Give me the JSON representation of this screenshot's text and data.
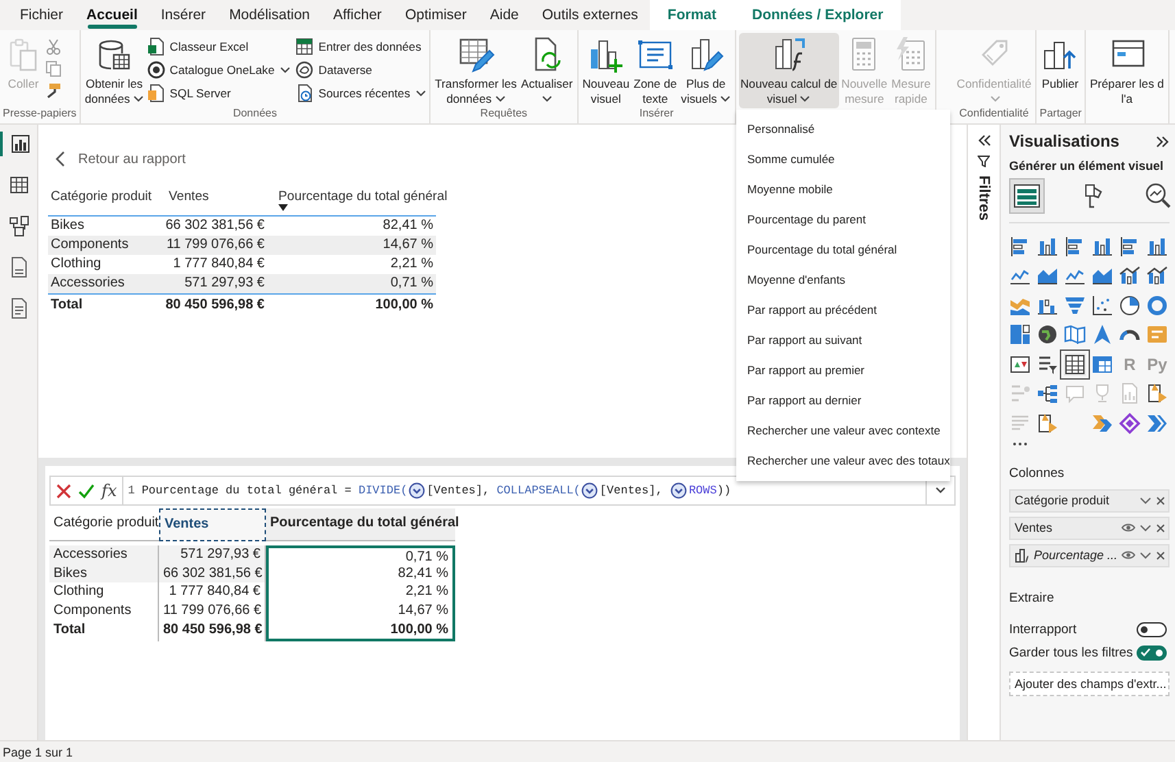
{
  "tabs": [
    {
      "label": "Fichier",
      "selected": false,
      "contextual": false
    },
    {
      "label": "Accueil",
      "selected": true,
      "contextual": false
    },
    {
      "label": "Insérer",
      "selected": false,
      "contextual": false
    },
    {
      "label": "Modélisation",
      "selected": false,
      "contextual": false
    },
    {
      "label": "Afficher",
      "selected": false,
      "contextual": false
    },
    {
      "label": "Optimiser",
      "selected": false,
      "contextual": false
    },
    {
      "label": "Aide",
      "selected": false,
      "contextual": false
    },
    {
      "label": "Outils externes",
      "selected": false,
      "contextual": false
    },
    {
      "label": "Format",
      "selected": false,
      "contextual": true
    },
    {
      "label": "Données / Explorer",
      "selected": false,
      "contextual": true
    }
  ],
  "ribbon": {
    "groups": [
      {
        "label": "Presse-papiers",
        "buttons": [
          {
            "kind": "large",
            "lines": [
              "Coller"
            ],
            "menu": false,
            "disabled": true,
            "pressed": false
          }
        ]
      },
      {
        "label": "Données",
        "buttons": [
          {
            "kind": "large",
            "lines": [
              "Obtenir les",
              "données"
            ],
            "menu": true,
            "disabled": false,
            "pressed": false
          },
          {
            "kind": "small",
            "label": "Classeur Excel",
            "menu": false
          },
          {
            "kind": "small",
            "label": "Catalogue OneLake",
            "menu": true
          },
          {
            "kind": "small",
            "label": "SQL Server",
            "menu": false
          },
          {
            "kind": "small",
            "label": "Entrer des données",
            "menu": false
          },
          {
            "kind": "small",
            "label": "Dataverse",
            "menu": false
          },
          {
            "kind": "small",
            "label": "Sources récentes",
            "menu": true
          }
        ]
      },
      {
        "label": "Requêtes",
        "buttons": [
          {
            "kind": "large",
            "lines": [
              "Transformer les",
              "données"
            ],
            "menu": true,
            "disabled": false,
            "pressed": false
          },
          {
            "kind": "large",
            "lines": [
              "Actualiser"
            ],
            "menu": true,
            "disabled": false,
            "pressed": false
          }
        ]
      },
      {
        "label": "Insérer",
        "buttons": [
          {
            "kind": "large",
            "lines": [
              "Nouveau",
              "visuel"
            ],
            "menu": false,
            "disabled": false,
            "pressed": false
          },
          {
            "kind": "large",
            "lines": [
              "Zone de",
              "texte"
            ],
            "menu": false,
            "disabled": false,
            "pressed": false
          },
          {
            "kind": "large",
            "lines": [
              "Plus de",
              "visuels"
            ],
            "menu": true,
            "disabled": false,
            "pressed": false
          }
        ]
      },
      {
        "buttons": [
          {
            "kind": "large",
            "lines": [
              "Nouveau calcul de",
              "visuel"
            ],
            "menu": true,
            "disabled": false,
            "pressed": true
          },
          {
            "kind": "large",
            "lines": [
              "Nouvelle",
              "mesure"
            ],
            "menu": false,
            "disabled": true,
            "pressed": false
          },
          {
            "kind": "large",
            "lines": [
              "Mesure",
              "rapide"
            ],
            "menu": false,
            "disabled": true,
            "pressed": false
          }
        ]
      },
      {
        "label": "Confidentialité",
        "buttons": [
          {
            "kind": "large",
            "lines": [
              "Confidentialité"
            ],
            "menu": true,
            "disabled": true,
            "pressed": false
          }
        ]
      },
      {
        "label": "Partager",
        "buttons": [
          {
            "kind": "large",
            "lines": [
              "Publier"
            ],
            "menu": false,
            "disabled": false,
            "pressed": false
          }
        ]
      },
      {
        "buttons": [
          {
            "kind": "large",
            "lines": [
              "Préparer les d",
              "l'a"
            ],
            "menu": false,
            "disabled": false,
            "pressed": false
          }
        ]
      }
    ]
  },
  "menu": {
    "items": [
      "Personnalisé",
      "Somme cumulée",
      "Moyenne mobile",
      "Pourcentage du parent",
      "Pourcentage du total général",
      "Moyenne d'enfants",
      "Par rapport au précédent",
      "Par rapport au suivant",
      "Par rapport au premier",
      "Par rapport au dernier",
      "Rechercher une valeur avec contexte",
      "Rechercher une valeur avec des totaux"
    ]
  },
  "left_nav": [
    {
      "selected": true
    },
    {
      "selected": false
    },
    {
      "selected": false
    },
    {
      "selected": false
    },
    {
      "selected": false
    }
  ],
  "report": {
    "back_link": "Retour au rapport",
    "columns": [
      {
        "label": "Catégorie produit",
        "sorted": false
      },
      {
        "label": "Ventes",
        "sorted": false
      },
      {
        "label": "Pourcentage du total général",
        "sorted": true
      }
    ],
    "rows": [
      [
        "Bikes",
        "66 302 381,56 €",
        "82,41 %"
      ],
      [
        "Components",
        "11 799 076,66 €",
        "14,67 %"
      ],
      [
        "Clothing",
        "1 777 840,84 €",
        "2,21 %"
      ],
      [
        "Accessories",
        "571 297,93 €",
        "0,71 %"
      ]
    ],
    "total": [
      "Total",
      "80 450 596,98 €",
      "100,00 %"
    ]
  },
  "formula_bar": {
    "fx_label": "fx",
    "line_number": "1",
    "tokens": [
      {
        "kind": "plain",
        "text": "Pourcentage du total général = "
      },
      {
        "kind": "function",
        "text": "DIVIDE("
      },
      {
        "kind": "marker"
      },
      {
        "kind": "plain",
        "text": "[Ventes], "
      },
      {
        "kind": "function",
        "text": "COLLAPSEALL("
      },
      {
        "kind": "marker"
      },
      {
        "kind": "plain",
        "text": "[Ventes], "
      },
      {
        "kind": "marker"
      },
      {
        "kind": "keyword",
        "text": "ROWS"
      },
      {
        "kind": "plain",
        "text": "))"
      }
    ]
  },
  "visual_grid": {
    "columns": [
      {
        "label": "Catégorie produit",
        "kind": "field",
        "selected": false
      },
      {
        "label": "Ventes",
        "kind": "field",
        "selected": true
      },
      {
        "label": "Pourcentage du total général",
        "kind": "calculation",
        "selected": false
      }
    ],
    "rows": [
      [
        "Accessories",
        "571 297,93 €",
        "0,71 %"
      ],
      [
        "Bikes",
        "66 302 381,56 €",
        "82,41 %"
      ],
      [
        "Clothing",
        "1 777 840,84 €",
        "2,21 %"
      ],
      [
        "Components",
        "11 799 076,66 €",
        "14,67 %"
      ]
    ],
    "total": [
      "Total",
      "80 450 596,98 €",
      "100,00 %"
    ]
  },
  "filters_pane": {
    "label": "Filtres"
  },
  "visualizations": {
    "title": "Visualisations",
    "subtitle": "Générer un élément visuel",
    "tabs": [
      {
        "selected": true
      },
      {
        "selected": false
      },
      {
        "selected": false
      }
    ],
    "visuals": [
      {
        "kind": "bar",
        "disabled": false,
        "selected": false
      },
      {
        "kind": "column",
        "disabled": false,
        "selected": false
      },
      {
        "kind": "bar",
        "disabled": false,
        "selected": false
      },
      {
        "kind": "column",
        "disabled": false,
        "selected": false
      },
      {
        "kind": "bar",
        "disabled": false,
        "selected": false
      },
      {
        "kind": "column",
        "disabled": false,
        "selected": false
      },
      {
        "kind": "line",
        "disabled": false,
        "selected": false
      },
      {
        "kind": "area",
        "disabled": false,
        "selected": false
      },
      {
        "kind": "line",
        "disabled": false,
        "selected": false
      },
      {
        "kind": "area",
        "disabled": false,
        "selected": false
      },
      {
        "kind": "combo",
        "disabled": false,
        "selected": false
      },
      {
        "kind": "combo",
        "disabled": false,
        "selected": false
      },
      {
        "kind": "ribbon",
        "disabled": false,
        "selected": false
      },
      {
        "kind": "waterfall",
        "disabled": false,
        "selected": false
      },
      {
        "kind": "funnel",
        "disabled": false,
        "selected": false
      },
      {
        "kind": "scatter",
        "disabled": false,
        "selected": false
      },
      {
        "kind": "pie",
        "disabled": false,
        "selected": false
      },
      {
        "kind": "donut",
        "disabled": false,
        "selected": false
      },
      {
        "kind": "treemap",
        "disabled": false,
        "selected": false
      },
      {
        "kind": "globe",
        "disabled": false,
        "selected": false
      },
      {
        "kind": "map",
        "disabled": false,
        "selected": false
      },
      {
        "kind": "navigation",
        "disabled": false,
        "selected": false
      },
      {
        "kind": "gauge",
        "disabled": false,
        "selected": false
      },
      {
        "kind": "card",
        "disabled": false,
        "selected": false
      },
      {
        "kind": "kpi",
        "disabled": false,
        "selected": false
      },
      {
        "kind": "slicer",
        "disabled": false,
        "selected": false
      },
      {
        "kind": "table",
        "disabled": false,
        "selected": true
      },
      {
        "kind": "matrix",
        "disabled": false,
        "selected": false
      },
      {
        "kind": "letter",
        "label": "R",
        "disabled": true,
        "selected": false
      },
      {
        "kind": "letter",
        "label": "Py",
        "disabled": true,
        "selected": false
      },
      {
        "kind": "influencers",
        "disabled": true,
        "selected": false
      },
      {
        "kind": "tree",
        "disabled": false,
        "selected": false
      },
      {
        "kind": "qa",
        "disabled": true,
        "selected": false
      },
      {
        "kind": "trophy",
        "disabled": true,
        "selected": false
      },
      {
        "kind": "report",
        "disabled": true,
        "selected": false
      },
      {
        "kind": "powerapps",
        "disabled": false,
        "selected": false
      },
      {
        "kind": "narrative",
        "disabled": true,
        "selected": false
      },
      {
        "kind": "powerapps",
        "disabled": false,
        "selected": false
      },
      {
        "kind": "automate",
        "disabled": false,
        "selected": false
      },
      {
        "kind": "diamond",
        "disabled": false,
        "selected": false
      },
      {
        "kind": "chevron",
        "disabled": false,
        "selected": false
      }
    ],
    "columns_title": "Colonnes",
    "fields": [
      {
        "label": "Catégorie produit",
        "kind": "column",
        "eye": false
      },
      {
        "label": "Ventes",
        "kind": "column",
        "eye": true
      },
      {
        "label": "Pourcentage ...",
        "kind": "calculation",
        "eye": true
      }
    ],
    "drillthrough_title": "Extraire",
    "toggles": [
      {
        "label": "Interrapport",
        "on": false
      },
      {
        "label": "Garder tous les filtres",
        "on": true
      }
    ],
    "drop_zone": "Ajouter des champs d'extr..."
  },
  "status_bar": {
    "page": "Page 1 sur 1"
  }
}
